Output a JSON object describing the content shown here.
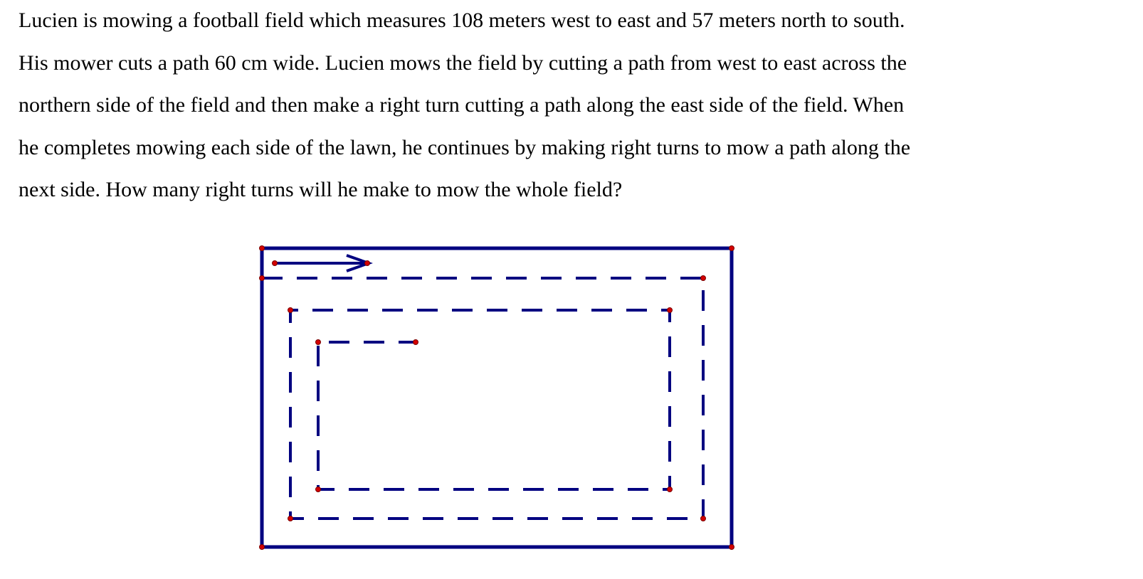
{
  "problem": {
    "lines": [
      "Lucien is mowing a football field which measures 108 meters west to east and 57 meters north to south.",
      "His mower cuts a path 60 cm wide. Lucien mows the field by cutting a path from west to east across the",
      "northern side of the field and then make a right turn cutting a path along the east side of the field. When",
      "he completes mowing each side of the lawn, he continues by making right turns to mow a path along the",
      "next side. How many right turns will he make to mow the whole field?"
    ]
  },
  "diagram": {
    "line_color": "#000080",
    "point_color": "#d40000"
  }
}
